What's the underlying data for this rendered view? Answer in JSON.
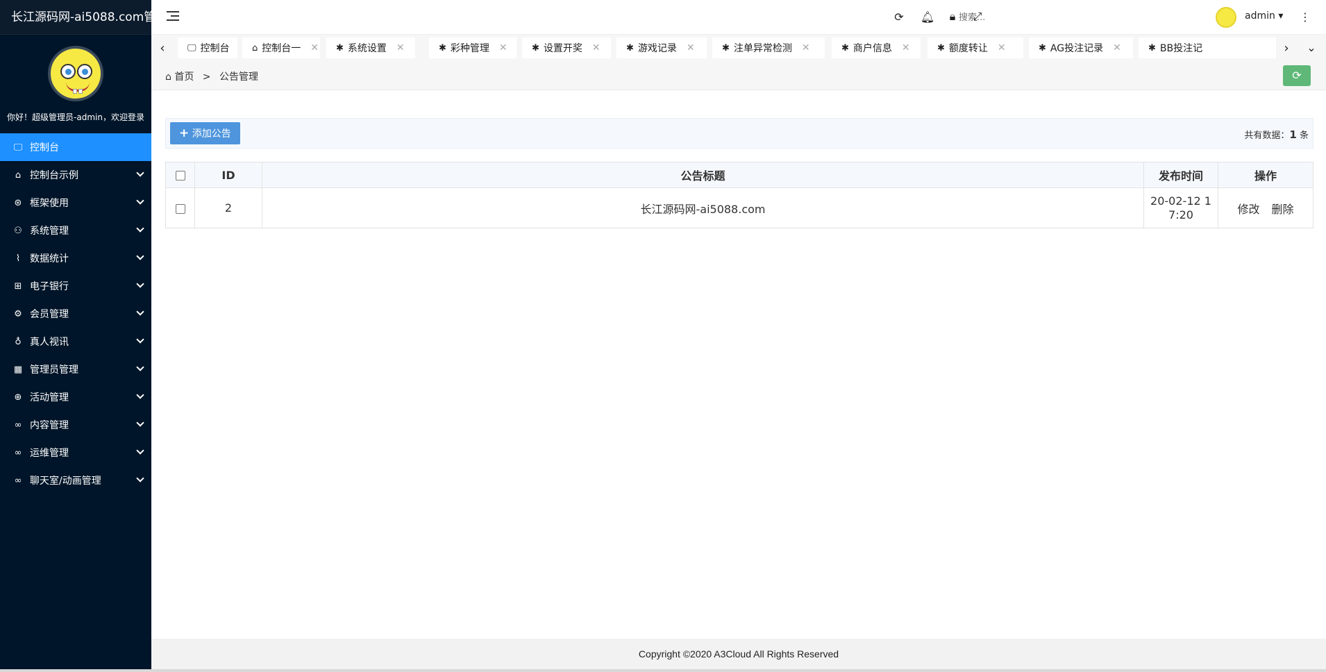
{
  "brand": {
    "title": "长江源码网-ai5088.com管"
  },
  "sidebar": {
    "welcome": "你好！超级管理员-admin，欢迎登录",
    "items": [
      {
        "label": "控制台",
        "icon": "monitor-icon",
        "glyph": "🖵",
        "active": true
      },
      {
        "label": "控制台示例",
        "icon": "home-icon",
        "glyph": "⌂"
      },
      {
        "label": "框架使用",
        "icon": "ok-icon",
        "glyph": "⊛"
      },
      {
        "label": "系统管理",
        "icon": "user-icon",
        "glyph": "⚇"
      },
      {
        "label": "数据统计",
        "icon": "pulse-icon",
        "glyph": "⌇"
      },
      {
        "label": "电子银行",
        "icon": "bank-icon",
        "glyph": "⊞"
      },
      {
        "label": "会员管理",
        "icon": "gear-icon",
        "glyph": "⚙"
      },
      {
        "label": "真人视讯",
        "icon": "video-icon",
        "glyph": "♁"
      },
      {
        "label": "管理员管理",
        "icon": "grid-icon",
        "glyph": "▦"
      },
      {
        "label": "活动管理",
        "icon": "plus-circle-icon",
        "glyph": "⊕"
      },
      {
        "label": "内容管理",
        "icon": "link-icon",
        "glyph": "∞"
      },
      {
        "label": "运维管理",
        "icon": "link-icon",
        "glyph": "∞"
      },
      {
        "label": "聊天室/动画管理",
        "icon": "link-icon",
        "glyph": "∞"
      }
    ]
  },
  "topbar": {
    "search_placeholder": "搜索...",
    "username": "admin",
    "icons": [
      "refresh-icon",
      "bell-icon",
      "lock-icon",
      "fullscreen-icon",
      "more-icon"
    ]
  },
  "tabs": [
    {
      "label": "控制台",
      "icon": "monitor-icon",
      "glyph": "🖵",
      "closable": false
    },
    {
      "label": "控制台一",
      "icon": "home-icon",
      "glyph": "⌂",
      "closable": true
    },
    {
      "label": "系统设置",
      "icon": "palm-icon",
      "glyph": "✱",
      "closable": true
    },
    {
      "label": "彩种管理",
      "icon": "palm-icon",
      "glyph": "✱",
      "closable": true
    },
    {
      "label": "设置开奖",
      "icon": "palm-icon",
      "glyph": "✱",
      "closable": true
    },
    {
      "label": "游戏记录",
      "icon": "palm-icon",
      "glyph": "✱",
      "closable": true
    },
    {
      "label": "注单异常检测",
      "icon": "palm-icon",
      "glyph": "✱",
      "closable": true
    },
    {
      "label": "商户信息",
      "icon": "palm-icon",
      "glyph": "✱",
      "closable": true
    },
    {
      "label": "额度转让",
      "icon": "palm-icon",
      "glyph": "✱",
      "closable": true
    },
    {
      "label": "AG投注记录",
      "icon": "palm-icon",
      "glyph": "✱",
      "closable": true
    },
    {
      "label": "BB投注记",
      "icon": "palm-icon",
      "glyph": "✱",
      "closable": false
    }
  ],
  "breadcrumb": {
    "home": "首页",
    "sep": ">",
    "current": "公告管理"
  },
  "toolbar": {
    "add_label": "添加公告",
    "total_prefix": "共有数据：",
    "total_count": "1",
    "total_suffix": " 条"
  },
  "table": {
    "headers": [
      "ID",
      "公告标题",
      "发布时间",
      "操作"
    ],
    "rows": [
      {
        "id": "2",
        "title": "长江源码网-ai5088.com",
        "time_line1": "20-02-12 1",
        "time_line2": "7:20",
        "edit": "修改",
        "delete": "删除"
      }
    ]
  },
  "footer": {
    "text": "Copyright ©2020 A3Cloud All Rights Reserved"
  },
  "colors": {
    "sidebar_bg": "#001529",
    "active_item": "#1e90ff",
    "add_button": "#4e95dd",
    "refresh_button": "#5fb878"
  }
}
